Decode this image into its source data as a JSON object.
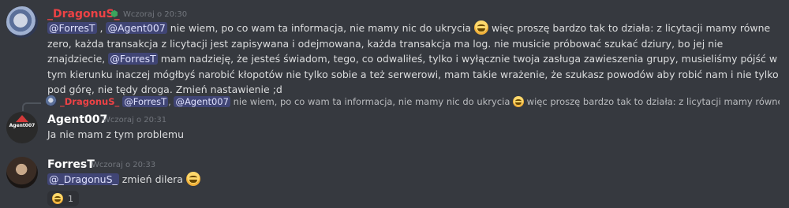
{
  "messages": [
    {
      "author": "_DragonuS_",
      "author_color": "#ed4245",
      "timestamp": "Wczoraj o 20:30",
      "mention_forrest": "@ForresT",
      "mention_agent": "@Agent007",
      "text_1": " nie wiem, po co wam ta informacja, nie mamy nic do ukrycia ",
      "text_2": " więc proszę bardzo tak to działa: z licytacji mamy równe zero, każda transakcja z licytacji jest zapisywana i odejmowana, każda transakcja ma log. nie musicie próbować szukać dziury, bo jej nie znajdziecie, ",
      "mention_forrest_2": "@ForresT",
      "text_3": " mam nadzieję, że jesteś świadom, tego, co odwaliłeś, tylko i wyłącznie twoja zasługa zawieszenia grupy, musieliśmy pójść w tym kierunku inaczej mógłbyś narobić kłopotów nie tylko sobie a też serwerowi, mam takie wrażenie, że szukasz powodów aby robić nam i nie tylko pod górę, nie tędy droga. Zmień nastawienie ;d"
    },
    {
      "author": "Agent007",
      "author_color": "#ffffff",
      "timestamp": "Wczoraj o 20:31",
      "reply_author": "_DragonuS_",
      "reply_mention_1": "@ForresT",
      "reply_mention_2": "@Agent007",
      "reply_text_1": " nie wiem, po co wam ta informacja, nie mamy nic do ukrycia ",
      "reply_text_2": " więc proszę bardzo tak to działa: z licytacji mamy równe zero, każda tra...",
      "avatar_label": "Agent007",
      "text": "Ja nie mam z tym problemu"
    },
    {
      "author": "ForresT",
      "author_color": "#ffffff",
      "timestamp": "Wczoraj o 20:33",
      "mention": "@_DragonuS_",
      "text": " zmień dilera ",
      "reaction_count": "1"
    }
  ]
}
